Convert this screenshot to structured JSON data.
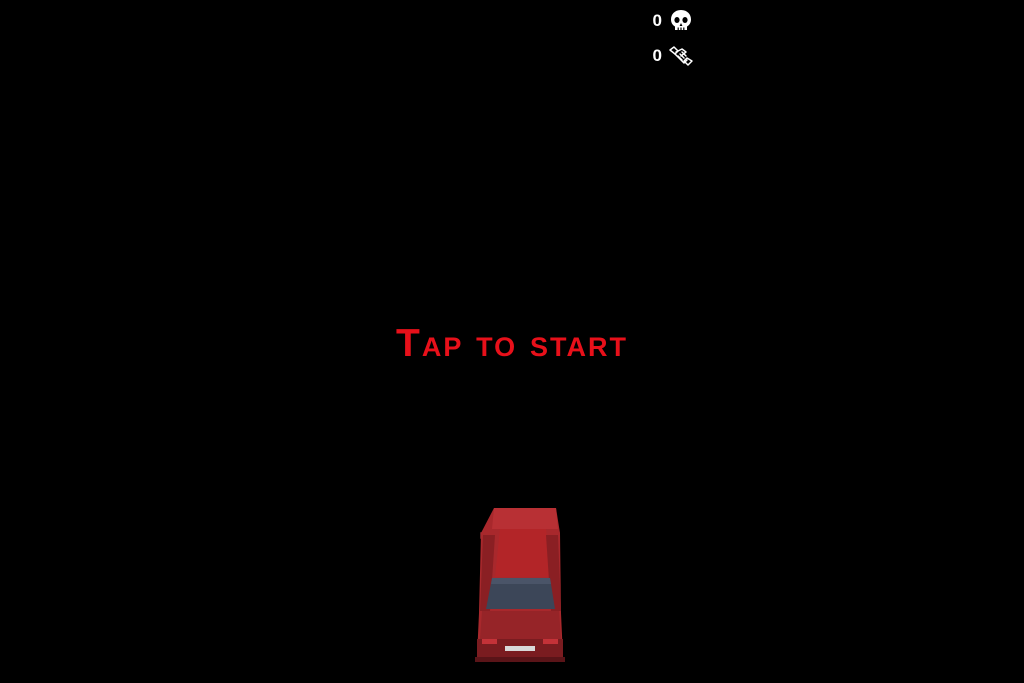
{
  "hud": {
    "kills": {
      "value": "0",
      "icon": "skull-icon"
    },
    "hands": {
      "value": "0",
      "icon": "handshake-icon"
    }
  },
  "start_prompt": "Tap to start",
  "colors": {
    "background": "#000000",
    "prompt": "#e8101a",
    "hud_text": "#ffffff",
    "car_body": "#a8282c",
    "car_window": "#3c4658"
  }
}
